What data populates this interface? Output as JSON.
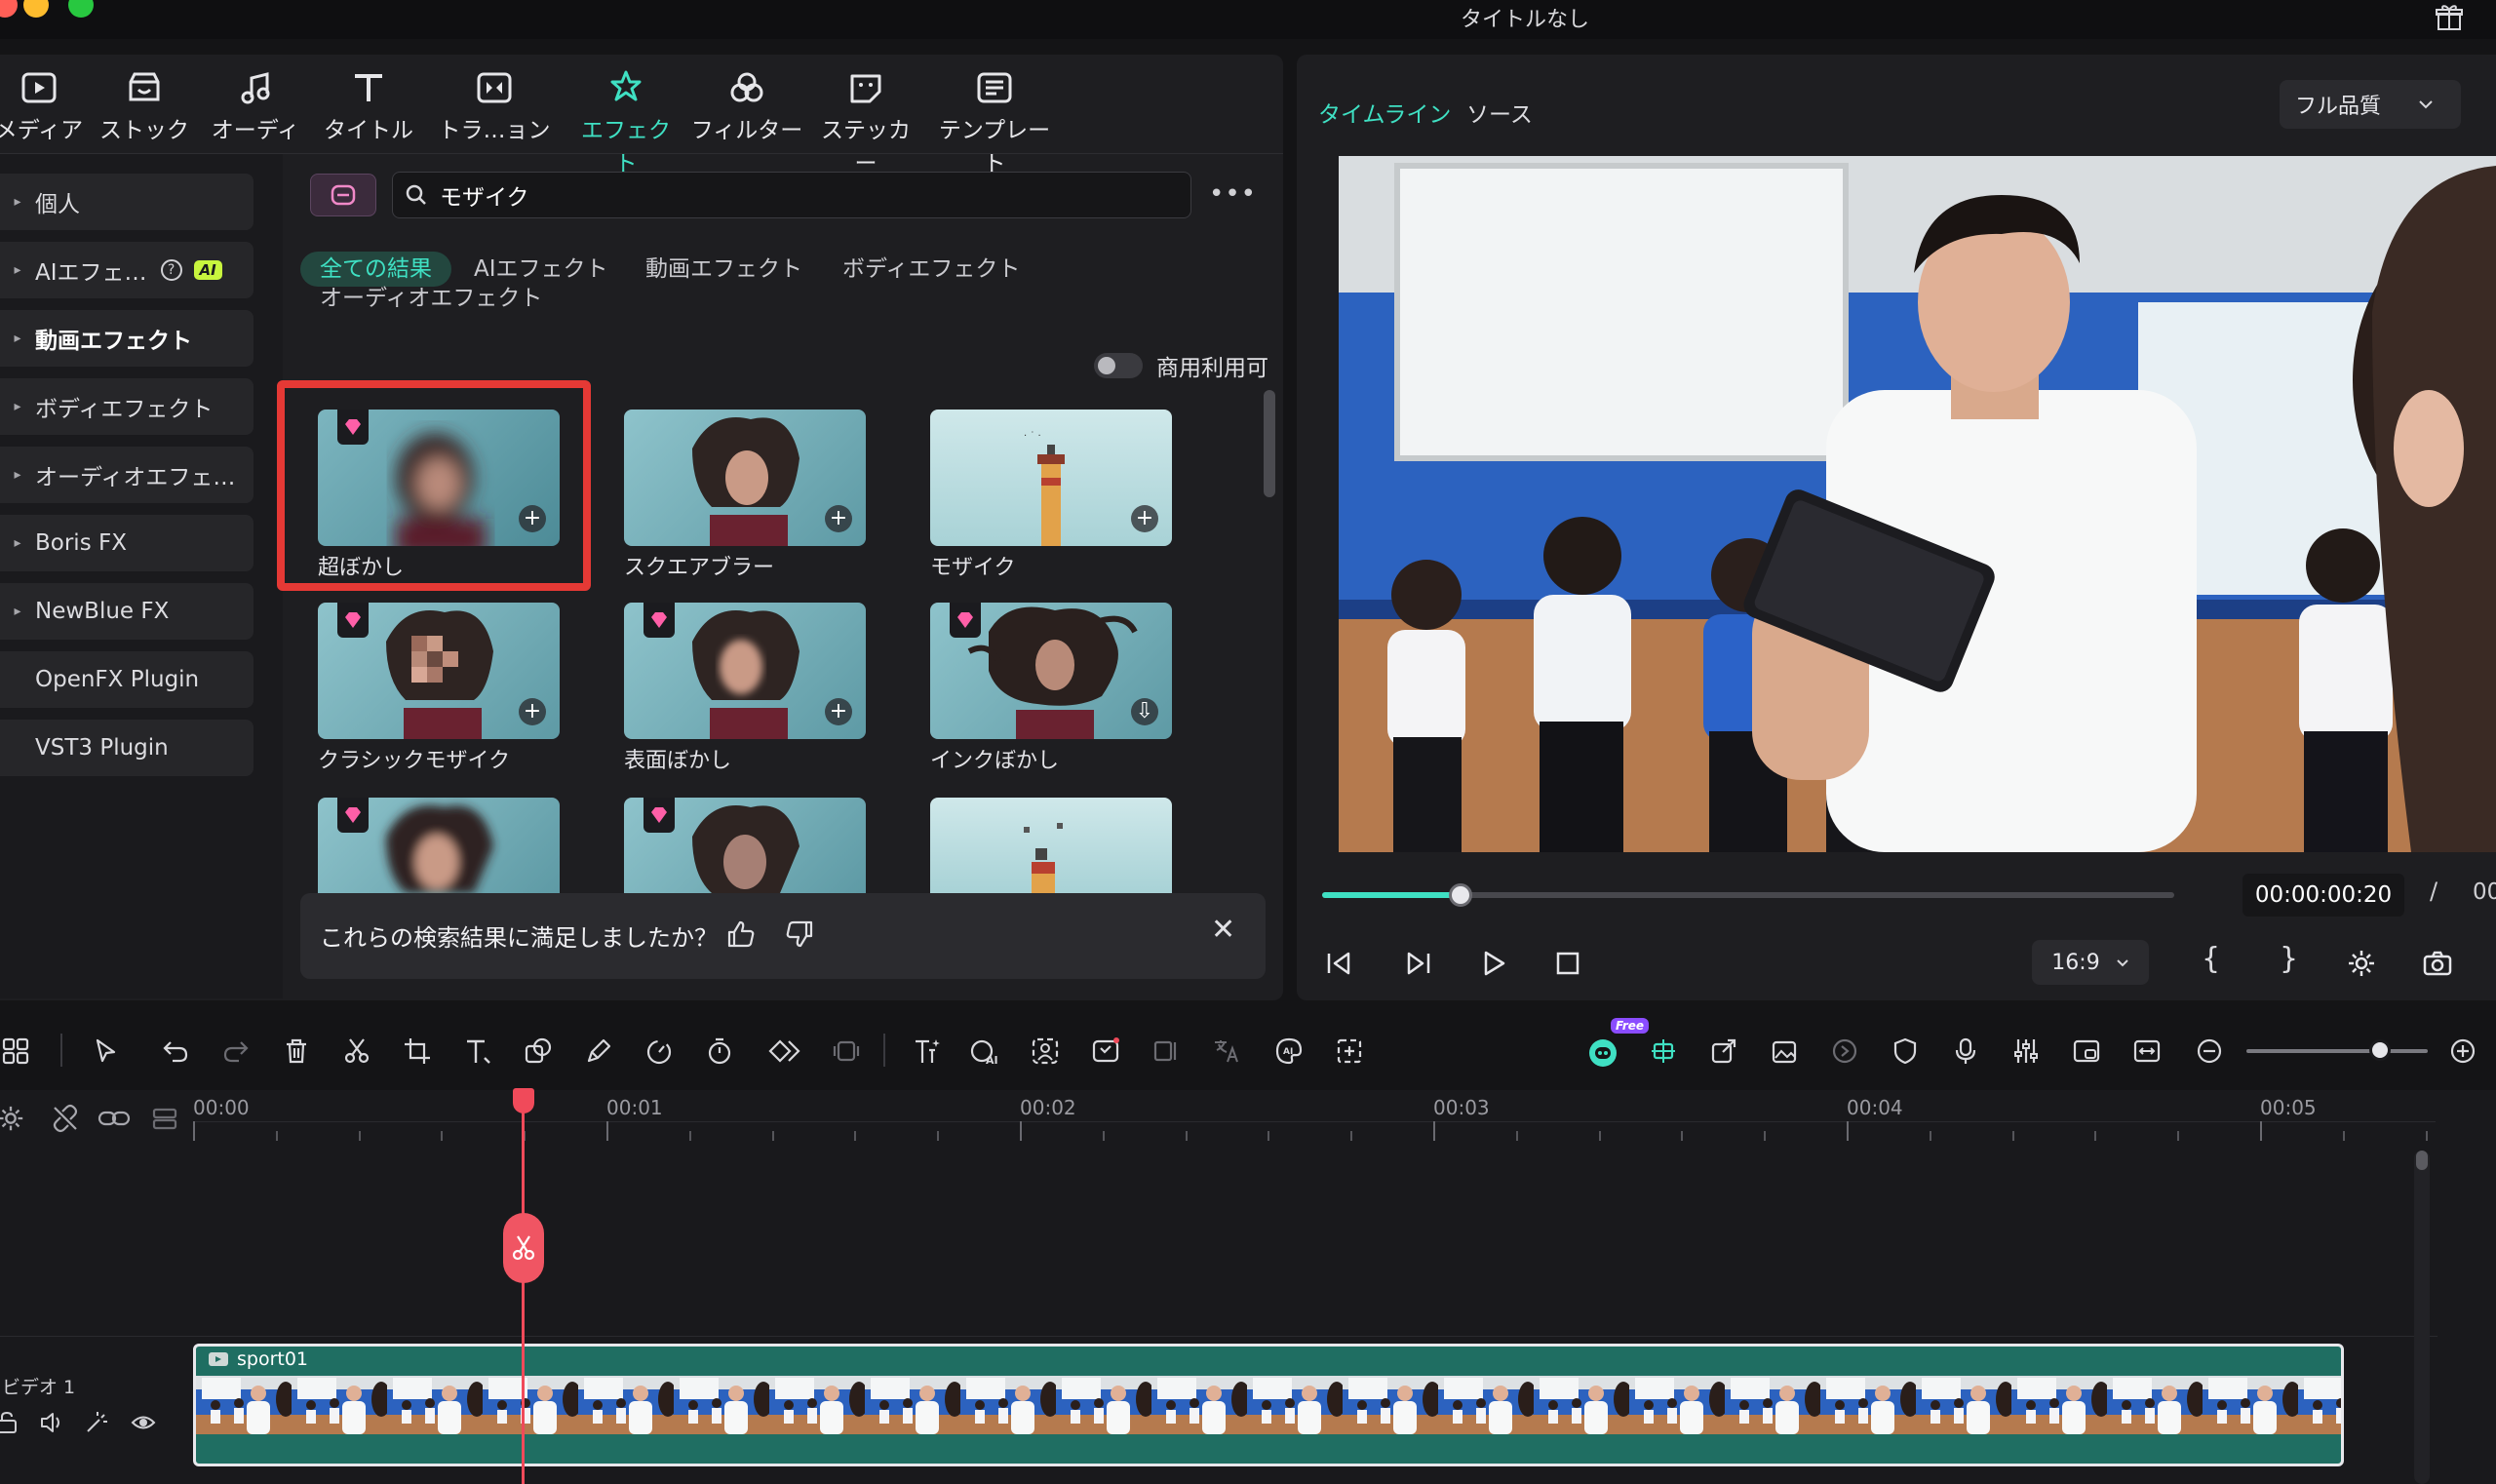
{
  "window": {
    "title": "タイトルなし",
    "traffic_colors": [
      "#ff5f57",
      "#febc2e",
      "#28c840"
    ]
  },
  "nav": {
    "items": [
      {
        "label": "メディア",
        "icon": "media-icon"
      },
      {
        "label": "ストック",
        "icon": "stock-icon"
      },
      {
        "label": "オーディオ",
        "icon": "music-note-icon"
      },
      {
        "label": "タイトル",
        "icon": "title-t-icon"
      },
      {
        "label": "トラ…ョン",
        "icon": "transition-icon"
      },
      {
        "label": "エフェクト",
        "icon": "effects-star-icon",
        "active": true
      },
      {
        "label": "フィルター",
        "icon": "filter-icon"
      },
      {
        "label": "ステッカー",
        "icon": "sticker-icon"
      },
      {
        "label": "テンプレート",
        "icon": "template-icon"
      }
    ],
    "accent": "#3fe0c3"
  },
  "sidebar": {
    "items": [
      {
        "label": "個人",
        "arrow": true
      },
      {
        "label": "AIエフェ…",
        "arrow": true,
        "badge": "AI",
        "help": "?"
      },
      {
        "label": "動画エフェクト",
        "arrow": true,
        "bold": true
      },
      {
        "label": "ボディエフェクト",
        "arrow": true
      },
      {
        "label": "オーディオエフェ…",
        "arrow": true
      },
      {
        "label": "Boris FX",
        "arrow": true
      },
      {
        "label": "NewBlue FX",
        "arrow": true
      },
      {
        "label": "OpenFX Plugin",
        "arrow": false
      },
      {
        "label": "VST3 Plugin",
        "arrow": false
      }
    ]
  },
  "search": {
    "value": "モザイク",
    "more": "•••"
  },
  "filter_tabs": [
    {
      "label": "全ての結果",
      "active": true
    },
    {
      "label": "AIエフェクト"
    },
    {
      "label": "動画エフェクト"
    },
    {
      "label": "ボディエフェクト"
    },
    {
      "label": "オーディオエフェクト"
    }
  ],
  "commercial_toggle": {
    "label": "商用利用可",
    "on": false
  },
  "effects": [
    {
      "label": "超ぼかし",
      "premium": true,
      "action": "add",
      "selected": true
    },
    {
      "label": "スクエアブラー",
      "premium": false,
      "action": "add"
    },
    {
      "label": "モザイク",
      "premium": false,
      "action": "add"
    },
    {
      "label": "クラシックモザイク",
      "premium": true,
      "action": "add"
    },
    {
      "label": "表面ぼかし",
      "premium": true,
      "action": "add"
    },
    {
      "label": "インクぼかし",
      "premium": true,
      "action": "download"
    },
    {
      "label": "",
      "premium": true
    },
    {
      "label": "",
      "premium": true
    },
    {
      "label": "",
      "premium": false
    }
  ],
  "feedback": {
    "question": "これらの検索結果に満足しましたか？",
    "close": "✕"
  },
  "preview": {
    "tabs": [
      {
        "label": "タイムライン",
        "active": true
      },
      {
        "label": "ソース"
      }
    ],
    "quality": "フル品質",
    "timecode": "00:00:00:20",
    "slash": "/",
    "total_partial": "00",
    "progress_fraction": 0.1,
    "aspect_ratio": "16:9",
    "brace_open": "{",
    "brace_close": "}"
  },
  "timeline": {
    "ruler": [
      "00:00",
      "00:01",
      "00:02",
      "00:03",
      "00:04",
      "00:05"
    ],
    "track_label": "ビデオ 1",
    "clip_name": "sport01",
    "free_badge": "Free"
  }
}
